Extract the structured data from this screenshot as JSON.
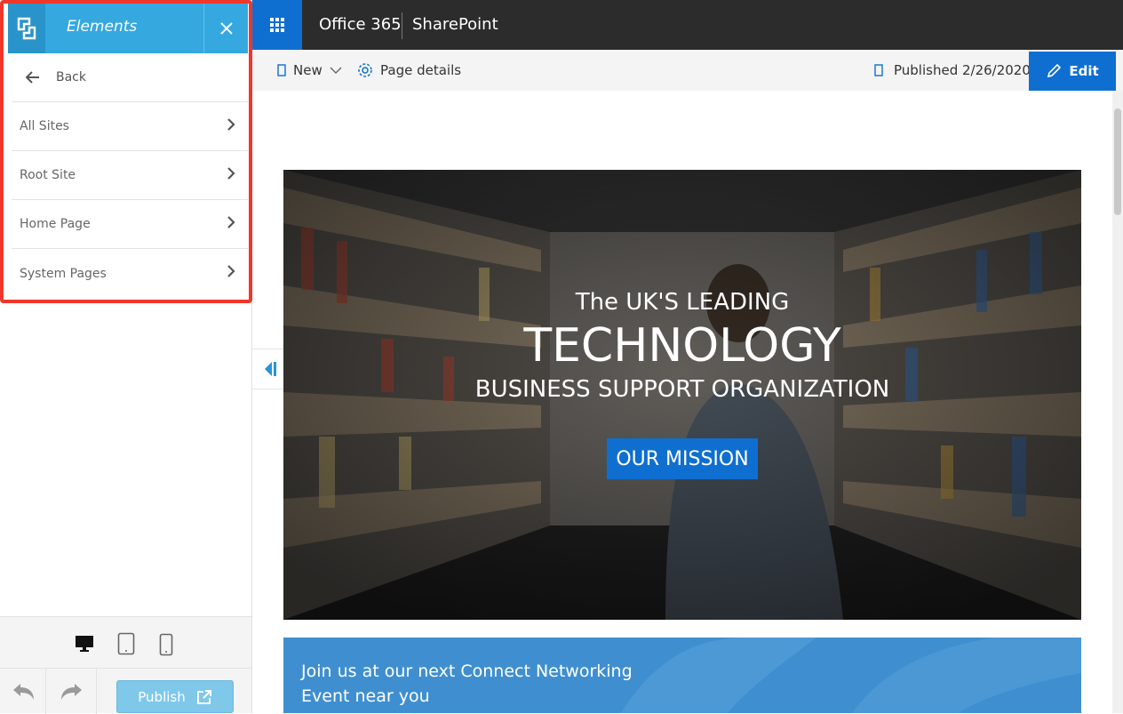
{
  "panel": {
    "title": "Elements",
    "back_label": "Back",
    "items": [
      {
        "label": "All Sites"
      },
      {
        "label": "Root Site"
      },
      {
        "label": "Home Page"
      },
      {
        "label": "System Pages"
      }
    ],
    "publish_label": "Publish",
    "devices": [
      "desktop-icon",
      "tablet-icon",
      "phone-icon"
    ]
  },
  "topbar": {
    "brand": "Office 365",
    "app": "SharePoint"
  },
  "command_bar": {
    "new_label": "New",
    "page_details_label": "Page details",
    "published_label": "Published 2/26/2020",
    "edit_label": "Edit"
  },
  "hero": {
    "line1": "The UK'S LEADING",
    "line2": "TECHNOLOGY",
    "line3": "BUSINESS SUPPORT ORGANIZATION",
    "button_label": "OUR MISSION"
  },
  "event": {
    "text": "Join us at our next Connect Networking Event near you"
  },
  "colors": {
    "accent_blue": "#0f6fd1",
    "panel_blue": "#35a8e0",
    "highlight_red": "#f0372a",
    "topbar_dark": "#2c2c2c"
  }
}
